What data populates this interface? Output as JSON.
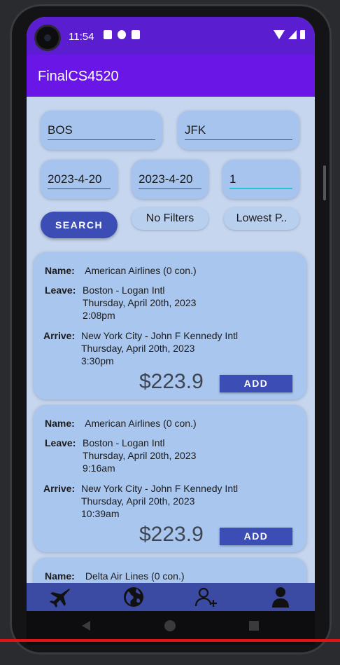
{
  "status_bar": {
    "time": "11:54"
  },
  "app_bar": {
    "title": "FinalCS4520"
  },
  "search": {
    "origin": "BOS",
    "destination": "JFK",
    "depart_date": "2023-4-20",
    "return_date": "2023-4-20",
    "passengers": "1",
    "search_label": "SEARCH",
    "filter_label": "No Filters",
    "sort_label": "Lowest P.."
  },
  "flights": [
    {
      "name_label": "Name:",
      "name": "American Airlines (0 con.)",
      "leave_label": "Leave:",
      "leave_airport": "Boston - Logan Intl",
      "leave_date": "Thursday, April 20th, 2023",
      "leave_time": "2:08pm",
      "arrive_label": "Arrive:",
      "arrive_airport": "New York City - John F Kennedy Intl",
      "arrive_date": "Thursday, April 20th, 2023",
      "arrive_time": "3:30pm",
      "price": "$223.9",
      "add_label": "ADD"
    },
    {
      "name_label": "Name:",
      "name": "American Airlines (0 con.)",
      "leave_label": "Leave:",
      "leave_airport": "Boston - Logan Intl",
      "leave_date": "Thursday, April 20th, 2023",
      "leave_time": "9:16am",
      "arrive_label": "Arrive:",
      "arrive_airport": "New York City - John F Kennedy Intl",
      "arrive_date": "Thursday, April 20th, 2023",
      "arrive_time": "10:39am",
      "price": "$223.9",
      "add_label": "ADD"
    },
    {
      "name_label": "Name:",
      "name": "Delta Air Lines (0 con.)"
    }
  ],
  "bottom_nav": {
    "items": [
      {
        "icon": "airplane-icon"
      },
      {
        "icon": "globe-icon"
      },
      {
        "icon": "add-person-icon"
      },
      {
        "icon": "person-icon"
      }
    ]
  },
  "colors": {
    "status_bar": "#5a1ed0",
    "app_bar": "#6a16e6",
    "accent": "#3c4db5",
    "card": "#a9c6ee",
    "background": "#c6d6ee"
  }
}
